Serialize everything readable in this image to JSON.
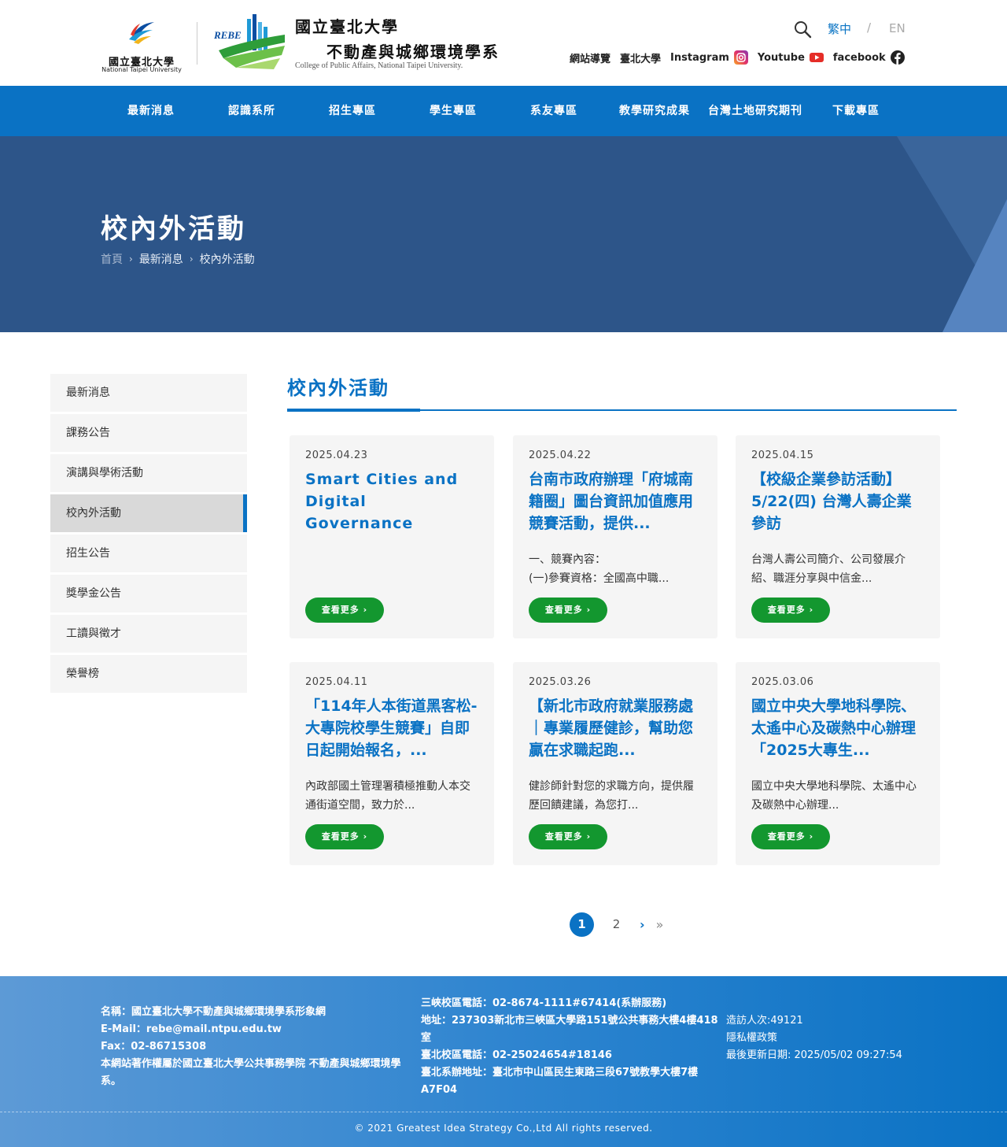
{
  "header": {
    "ntpu_name_cn": "國立臺北大學",
    "ntpu_name_en": "National Taipei University",
    "rebe_mark": "REBE",
    "dept_name_line1": "國立臺北大學",
    "dept_name_line2": "不動產與城鄉環境學系",
    "dept_name_en": "College of Public Affairs, National Taipei University.",
    "lang_current": "繁中",
    "lang_sep": "/",
    "lang_other": "EN",
    "links": [
      {
        "label": "網站導覽"
      },
      {
        "label": "臺北大學"
      },
      {
        "label": "Instagram",
        "icon": "instagram-icon"
      },
      {
        "label": "Youtube",
        "icon": "youtube-icon"
      },
      {
        "label": "facebook",
        "icon": "facebook-icon"
      }
    ]
  },
  "nav": {
    "items": [
      "最新消息",
      "認識系所",
      "招生專區",
      "學生專區",
      "系友專區",
      "教學研究成果",
      "台灣土地研究期刊",
      "下載專區"
    ]
  },
  "banner": {
    "title": "校內外活動",
    "breadcrumb": [
      "首頁",
      "最新消息",
      "校內外活動"
    ]
  },
  "sidebar": {
    "items": [
      "最新消息",
      "課務公告",
      "演講與學術活動",
      "校內外活動",
      "招生公告",
      "獎學金公告",
      "工讀與徵才",
      "榮譽榜"
    ],
    "active_index": 3
  },
  "main": {
    "title": "校內外活動",
    "more_label": "查看更多 ›",
    "cards": [
      {
        "date": "2025.04.23",
        "title": "Smart Cities and Digital Governance Workshop Forum",
        "excerpt": ""
      },
      {
        "date": "2025.04.22",
        "title": "台南市政府辦理「府城南籍圈」圖台資訊加值應用競賽活動，提供...",
        "excerpt": "一、競賽內容：\n(一)參賽資格：全國高中職..."
      },
      {
        "date": "2025.04.15",
        "title": "【校級企業參訪活動】5/22(四) 台灣人壽企業參訪",
        "excerpt": "台灣人壽公司簡介、公司發展介紹、職涯分享與中信金..."
      },
      {
        "date": "2025.04.11",
        "title": "「114年人本街道黑客松-大專院校學生競賽」自即日起開始報名，...",
        "excerpt": "內政部國土管理署積極推動人本交通街道空間，致力於..."
      },
      {
        "date": "2025.03.26",
        "title": "【新北市政府就業服務處｜專業履歷健診，幫助您贏在求職起跑...",
        "excerpt": "健診師針對您的求職方向，提供履歷回饋建議，為您打..."
      },
      {
        "date": "2025.03.06",
        "title": "國立中央大學地科學院、太遙中心及碳熱中心辦理「2025大專生...",
        "excerpt": "國立中央大學地科學院、太遙中心及碳熱中心辦理..."
      }
    ]
  },
  "pagination": {
    "current": "1",
    "next_page": "2",
    "next_symbol": "›",
    "last_symbol": "»"
  },
  "footer": {
    "col1": [
      "名稱：國立臺北大學不動產與城鄉環境學系形象網",
      "E-Mail：rebe@mail.ntpu.edu.tw",
      "Fax：02-86715308",
      "本網站著作權屬於國立臺北大學公共事務學院 不動產與城鄉環境學系。"
    ],
    "col2": [
      "三峽校區電話：02-8674-1111#67414(系辦服務)",
      "地址：237303新北市三峽區大學路151號公共事務大樓4樓418室",
      "臺北校區電話：02-25024654#18146",
      "臺北系辦地址：臺北市中山區民生東路三段67號教學大樓7樓A7F04"
    ],
    "col3": [
      "造訪人次:49121",
      "隱私權政策",
      "最後更新日期: 2025/05/02 09:27:54"
    ],
    "copyright": "© 2021 Greatest Idea Strategy Co.,Ltd All rights reserved."
  },
  "colors": {
    "primary": "#0a72c4",
    "banner": "#2d5589",
    "button_green": "#13972f"
  }
}
